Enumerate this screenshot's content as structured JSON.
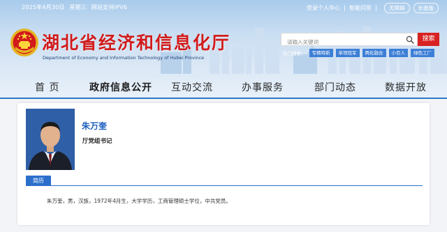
{
  "topbar": {
    "date": "2025年4月30日",
    "weekday": "星期三",
    "ipv6": "网站支持IPV6",
    "links": [
      "登录个人中心",
      "智能问答"
    ],
    "pills": [
      "无障碍",
      "长者版"
    ]
  },
  "site": {
    "title": "湖北省经济和信息化厅",
    "subtitle": "Department of Economy and Information Technology of Hubei Province"
  },
  "search": {
    "placeholder": "请输入关键词",
    "button_label": "搜索"
  },
  "hot_search": {
    "label": "热门搜索：",
    "tags": [
      "专精特新",
      "单项冠军",
      "两化融合",
      "小巨人",
      "绿色工厂"
    ]
  },
  "nav": {
    "items": [
      "首 页",
      "政府信息公开",
      "互动交流",
      "办事服务",
      "部门动态",
      "数据开放"
    ],
    "active_index": 1
  },
  "profile": {
    "name": "朱万奎",
    "position": "厅党组书记",
    "tab_label": "简历",
    "bio": "朱万奎，男，汉族，1972年4月生，大学学历，工商管理硕士学位，中共党员。"
  },
  "colors": {
    "brand_red": "#d11b1b",
    "accent_blue": "#2c6fcb",
    "name_blue": "#1f5fbf"
  }
}
